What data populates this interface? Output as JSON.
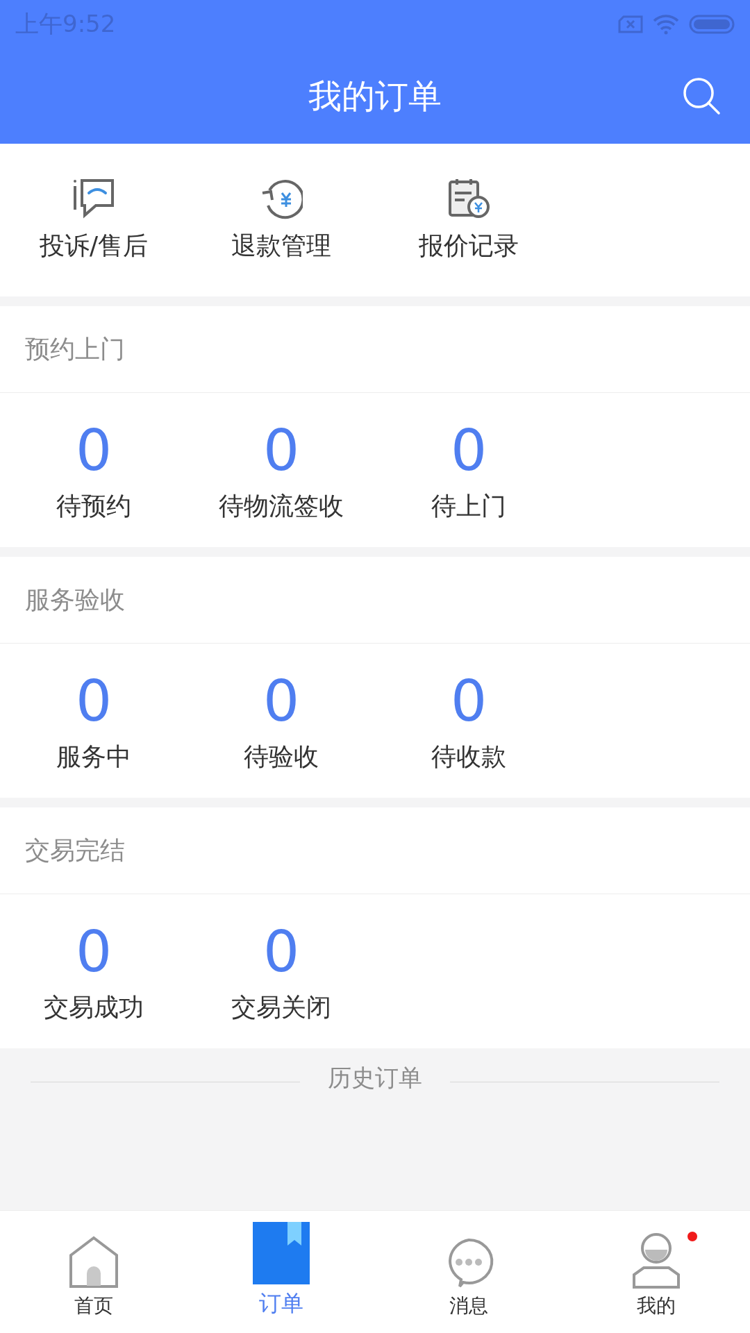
{
  "status_bar": {
    "time": "上午9:52"
  },
  "header": {
    "title": "我的订单"
  },
  "quick_actions": [
    {
      "label": "投诉/售后"
    },
    {
      "label": "退款管理"
    },
    {
      "label": "报价记录"
    }
  ],
  "sections": [
    {
      "title": "预约上门",
      "items": [
        {
          "count": "0",
          "label": "待预约"
        },
        {
          "count": "0",
          "label": "待物流签收"
        },
        {
          "count": "0",
          "label": "待上门"
        }
      ]
    },
    {
      "title": "服务验收",
      "items": [
        {
          "count": "0",
          "label": "服务中"
        },
        {
          "count": "0",
          "label": "待验收"
        },
        {
          "count": "0",
          "label": "待收款"
        }
      ]
    },
    {
      "title": "交易完结",
      "items": [
        {
          "count": "0",
          "label": "交易成功"
        },
        {
          "count": "0",
          "label": "交易关闭"
        }
      ]
    }
  ],
  "history": {
    "label": "历史订单"
  },
  "nav": [
    {
      "label": "首页",
      "selected": false,
      "badge": false
    },
    {
      "label": "订单",
      "selected": true,
      "badge": false
    },
    {
      "label": "消息",
      "selected": false,
      "badge": false
    },
    {
      "label": "我的",
      "selected": false,
      "badge": true
    }
  ]
}
